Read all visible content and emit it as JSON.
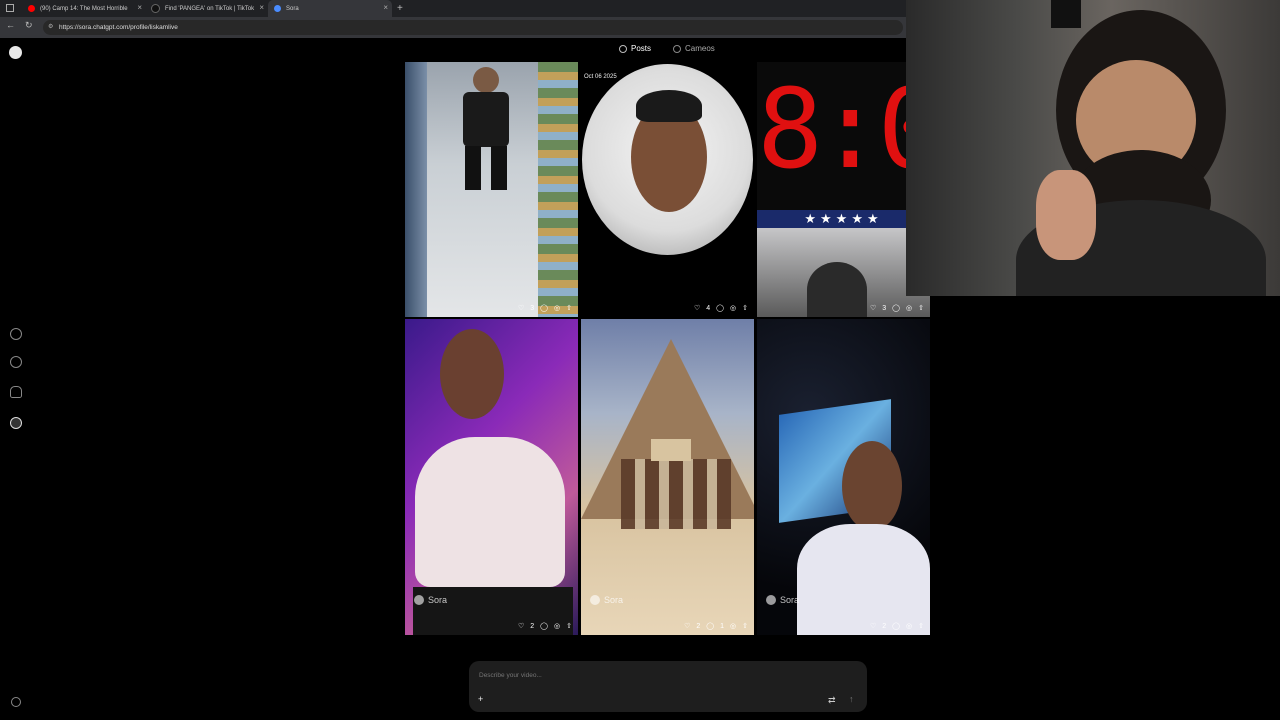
{
  "browser": {
    "tabs": [
      {
        "title": "(90) Camp 14: The Most Horrible",
        "fav_color": "#ff0000"
      },
      {
        "title": "Find 'PANGEA' on TikTok | TikTok",
        "fav_color": "#111111"
      },
      {
        "title": "Sora",
        "fav_color": "#4a8cff"
      }
    ],
    "new_tab": "+",
    "url": "https://sora.chatgpt.com/profile/liskamlive"
  },
  "header": {
    "tabs": [
      {
        "label": "Posts",
        "icon": "grid-icon"
      },
      {
        "label": "Cameos",
        "icon": "cameo-icon"
      }
    ]
  },
  "tiles": [
    {
      "scene": "store-aisle",
      "likes": "3",
      "comments": "",
      "watermark": "",
      "date": ""
    },
    {
      "scene": "peephole",
      "likes": "4",
      "comments": "",
      "watermark": "",
      "date": "Oct 06 2025"
    },
    {
      "scene": "clock",
      "likes": "3",
      "comments": "",
      "watermark": "",
      "date": ""
    },
    {
      "scene": "purple-room",
      "likes": "2",
      "comments": "",
      "watermark": "Sora",
      "date": ""
    },
    {
      "scene": "pyramid",
      "likes": "2",
      "comments": "1",
      "watermark": "Sora",
      "date": ""
    },
    {
      "scene": "cube-earth",
      "likes": "2",
      "comments": "",
      "watermark": "Sora",
      "date": ""
    }
  ],
  "clock_text": "8:0",
  "prompt": {
    "placeholder": "Describe your video...",
    "add_label": "+"
  }
}
